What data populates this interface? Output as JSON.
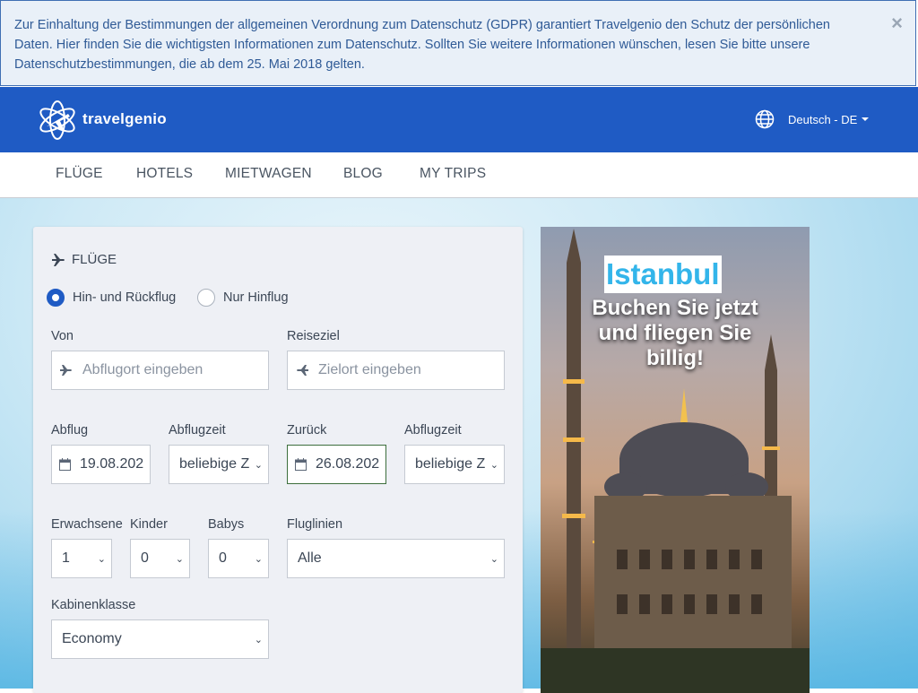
{
  "gdpr": {
    "text": "Zur Einhaltung der Bestimmungen der allgemeinen Verordnung zum Datenschutz (GDPR) garantiert Travelgenio den Schutz der persönlichen Daten. Hier finden Sie die wichtigsten Informationen zum Datenschutz. Sollten Sie weitere Informationen wünschen, lesen Sie bitte unsere Datenschutzbestimmungen, die ab dem 25. Mai 2018 gelten.",
    "close": "×"
  },
  "header": {
    "brand": "travelgenio",
    "language": "Deutsch - DE",
    "bg_color": "#1f5bc4"
  },
  "nav": {
    "items": [
      "FLÜGE",
      "HOTELS",
      "MIETWAGEN",
      "BLOG",
      "MY TRIPS"
    ]
  },
  "form": {
    "title": "FLÜGE",
    "trip_types": [
      "Hin- und Rückflug",
      "Nur Hinflug"
    ],
    "selected_trip_type": "Hin- und Rückflug",
    "from": {
      "label": "Von",
      "placeholder": "Abflugort eingeben"
    },
    "to": {
      "label": "Reiseziel",
      "placeholder": "Zielort eingeben"
    },
    "departure": {
      "label": "Abflug",
      "value": "19.08.202"
    },
    "departure_time": {
      "label": "Abflugzeit",
      "value": "beliebige Z"
    },
    "return": {
      "label": "Zurück",
      "value": "26.08.202"
    },
    "return_time": {
      "label": "Abflugzeit",
      "value": "beliebige Z"
    },
    "adults": {
      "label": "Erwachsene",
      "value": "1"
    },
    "children": {
      "label": "Kinder",
      "value": "0"
    },
    "babies": {
      "label": "Babys",
      "value": "0"
    },
    "airlines": {
      "label": "Fluglinien",
      "value": "Alle"
    },
    "cabin": {
      "label": "Kabinenklasse",
      "value": "Economy"
    }
  },
  "promo": {
    "city": "Istanbul",
    "tagline_1": "Buchen Sie jetzt",
    "tagline_2": "und fliegen Sie",
    "tagline_3": "billig!"
  }
}
